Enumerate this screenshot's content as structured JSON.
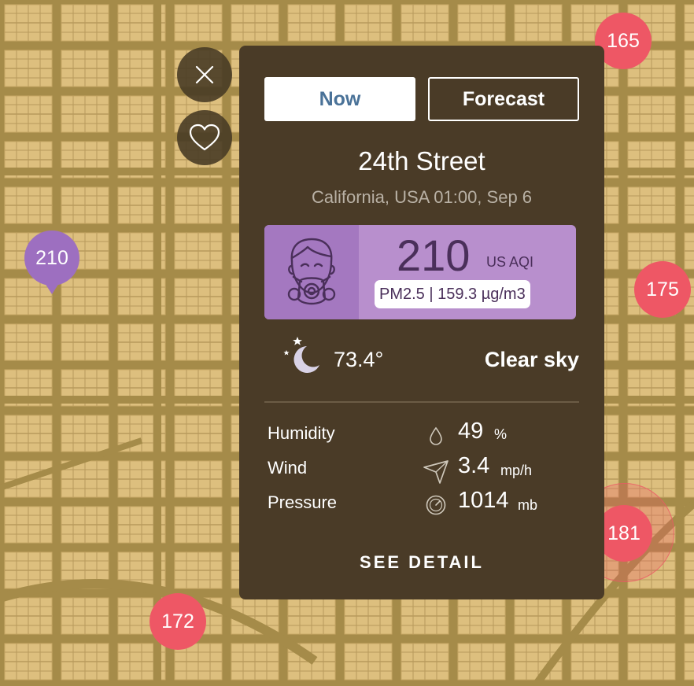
{
  "map": {
    "markers": [
      {
        "value": "165",
        "color": "#ee5765"
      },
      {
        "value": "210",
        "color": "#9d6fc0"
      },
      {
        "value": "175",
        "color": "#ee5765"
      },
      {
        "value": "181",
        "color": "#ee5765"
      },
      {
        "value": "172",
        "color": "#ee5765"
      }
    ]
  },
  "tabs": {
    "now_label": "Now",
    "forecast_label": "Forecast"
  },
  "station": {
    "name": "24th Street",
    "location_time": "California, USA 01:00, Sep 6"
  },
  "aqi": {
    "value": "210",
    "unit": "US AQI",
    "pollutant": "PM2.5 | 159.3 µg/m3",
    "color": "#b88fcd"
  },
  "weather": {
    "icon": "moon-stars-icon",
    "temperature": "73.4°",
    "condition": "Clear sky"
  },
  "stats": {
    "humidity_label": "Humidity",
    "humidity_value": "49",
    "humidity_unit": "%",
    "wind_label": "Wind",
    "wind_value": "3.4",
    "wind_unit": "mp/h",
    "pressure_label": "Pressure",
    "pressure_value": "1014",
    "pressure_unit": "mb"
  },
  "actions": {
    "see_detail_label": "SEE DETAIL"
  }
}
